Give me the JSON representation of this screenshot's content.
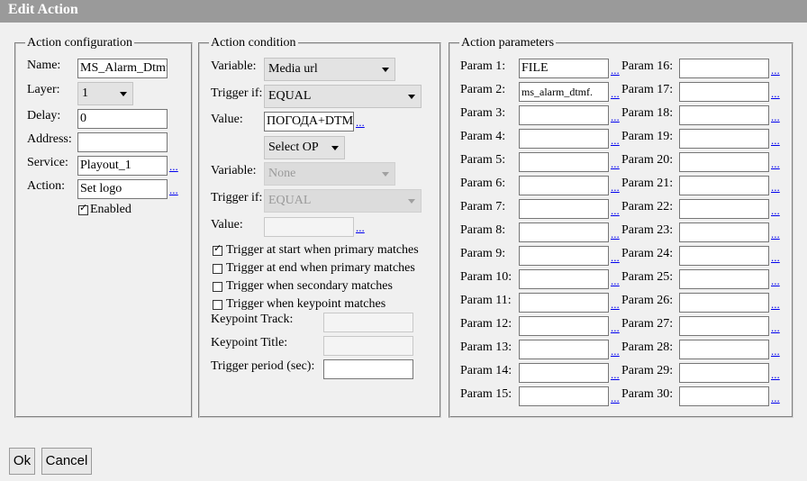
{
  "window": {
    "title": "Edit Action"
  },
  "action_config": {
    "legend": "Action configuration",
    "name_label": "Name:",
    "name_value": "MS_Alarm_Dtmf",
    "layer_label": "Layer:",
    "layer_value": "1",
    "delay_label": "Delay:",
    "delay_value": "0",
    "address_label": "Address:",
    "address_value": "",
    "service_label": "Service:",
    "service_value": "Playout_1",
    "action_label": "Action:",
    "action_value": "Set logo",
    "enabled_label": "Enabled",
    "enabled_checked": true,
    "browse": "..."
  },
  "action_condition": {
    "legend": "Action condition",
    "variable_label": "Variable:",
    "variable_value": "Media url",
    "trigger_if_label": "Trigger if:",
    "trigger_if_value": "EQUAL",
    "value_label": "Value:",
    "value_value": "ПОГОДА+DTMF",
    "select_op": "Select OP",
    "variable2_value": "None",
    "trigger_if2_value": "EQUAL",
    "value2_value": "",
    "checks": [
      {
        "label": "Trigger at start when primary matches",
        "checked": true
      },
      {
        "label": "Trigger at end when primary matches",
        "checked": false
      },
      {
        "label": "Trigger when secondary matches",
        "checked": false
      },
      {
        "label": "Trigger when keypoint matches",
        "checked": false
      }
    ],
    "keypoint_track_label": "Keypoint Track:",
    "keypoint_title_label": "Keypoint Title:",
    "trigger_period_label": "Trigger period (sec):",
    "trigger_period_value": "",
    "browse": "..."
  },
  "action_params": {
    "legend": "Action parameters",
    "browse": "...",
    "params": [
      {
        "label": "Param 1:",
        "value": "FILE"
      },
      {
        "label": "Param 2:",
        "value": "ms_alarm_dtmf."
      },
      {
        "label": "Param 3:",
        "value": ""
      },
      {
        "label": "Param 4:",
        "value": ""
      },
      {
        "label": "Param 5:",
        "value": ""
      },
      {
        "label": "Param 6:",
        "value": ""
      },
      {
        "label": "Param 7:",
        "value": ""
      },
      {
        "label": "Param 8:",
        "value": ""
      },
      {
        "label": "Param 9:",
        "value": ""
      },
      {
        "label": "Param 10:",
        "value": ""
      },
      {
        "label": "Param 11:",
        "value": ""
      },
      {
        "label": "Param 12:",
        "value": ""
      },
      {
        "label": "Param 13:",
        "value": ""
      },
      {
        "label": "Param 14:",
        "value": ""
      },
      {
        "label": "Param 15:",
        "value": ""
      },
      {
        "label": "Param 16:",
        "value": ""
      },
      {
        "label": "Param 17:",
        "value": ""
      },
      {
        "label": "Param 18:",
        "value": ""
      },
      {
        "label": "Param 19:",
        "value": ""
      },
      {
        "label": "Param 20:",
        "value": ""
      },
      {
        "label": "Param 21:",
        "value": ""
      },
      {
        "label": "Param 22:",
        "value": ""
      },
      {
        "label": "Param 23:",
        "value": ""
      },
      {
        "label": "Param 24:",
        "value": ""
      },
      {
        "label": "Param 25:",
        "value": ""
      },
      {
        "label": "Param 26:",
        "value": ""
      },
      {
        "label": "Param 27:",
        "value": ""
      },
      {
        "label": "Param 28:",
        "value": ""
      },
      {
        "label": "Param 29:",
        "value": ""
      },
      {
        "label": "Param 30:",
        "value": ""
      }
    ]
  },
  "buttons": {
    "ok": "Ok",
    "cancel": "Cancel"
  }
}
